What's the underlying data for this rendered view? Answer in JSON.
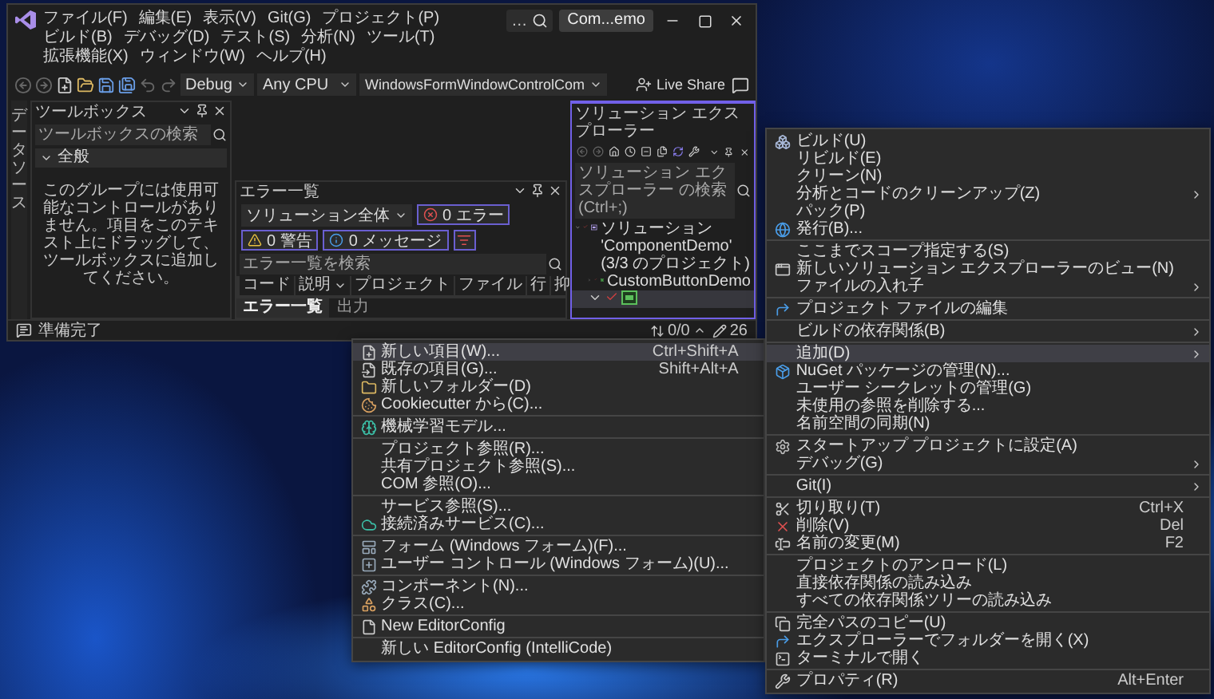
{
  "window": {
    "title": "Com...emo",
    "search_text": "…"
  },
  "menu_bar": [
    "ファイル(F)",
    "編集(E)",
    "表示(V)",
    "Git(G)",
    "プロジェクト(P)",
    "ビルド(B)",
    "デバッグ(D)",
    "テスト(S)",
    "分析(N)",
    "ツール(T)",
    "拡張機能(X)",
    "ウィンドウ(W)",
    "ヘルプ(H)"
  ],
  "toolbar": {
    "configuration": "Debug",
    "platform": "Any CPU",
    "startup_project": "WindowsFormWindowControlCom",
    "live_share": "Live Share"
  },
  "side_tabs": [
    {
      "label": "データソース"
    }
  ],
  "toolbox": {
    "title": "ツールボックス",
    "search_placeholder": "ツールボックスの検索",
    "groups": [
      {
        "label": "全般",
        "expanded": true,
        "message": "このグループには使用可能なコントロールがありません。項目をこのテキスト上にドラッグして、ツールボックスに追加してください。"
      }
    ]
  },
  "error_list": {
    "title": "エラー一覧",
    "scope": "ソリューション全体",
    "filters": [
      {
        "kind": "error",
        "label": "0 エラー",
        "selected": true
      },
      {
        "kind": "warning",
        "label": "0 警告",
        "selected": true
      },
      {
        "kind": "message",
        "label": "0 メッセージ",
        "selected": true
      }
    ],
    "search_placeholder": "エラー一覧を検索",
    "columns": [
      {
        "label": "コード",
        "has_menu": false
      },
      {
        "label": "説明",
        "has_menu": true
      },
      {
        "label": "プロジェクト",
        "has_menu": false
      },
      {
        "label": "ファイル",
        "has_menu": false
      },
      {
        "label": "行",
        "has_menu": false
      },
      {
        "label": "抑",
        "has_menu": false
      }
    ],
    "tabs": [
      {
        "label": "エラー一覧",
        "selected": true
      },
      {
        "label": "出力",
        "selected": false
      }
    ]
  },
  "solution_explorer": {
    "title": "ソリューション エクスプローラー",
    "search_placeholder": "ソリューション エクスプローラー の検索 (Ctrl+;)",
    "tree": [
      {
        "label": "ソリューション 'ComponentDemo' (3/3 のプロジェクト)",
        "kind": "solution",
        "expanded": true,
        "selected": false,
        "children": [
          {
            "label": "CustomButtonDemo",
            "kind": "project",
            "expanded": false,
            "selected": false
          },
          {
            "kind": "project",
            "expanded": true,
            "selected": true
          }
        ]
      }
    ]
  },
  "status_bar": {
    "text": "準備完了",
    "changes": "0/0",
    "edits": "26"
  },
  "context_menu": {
    "sections": [
      [
        {
          "label": "ビルド(U)",
          "kind": "build",
          "submenu": false,
          "highlighted": false
        },
        {
          "label": "リビルド(E)",
          "kind": "plain",
          "submenu": false,
          "highlighted": false
        },
        {
          "label": "クリーン(N)",
          "kind": "plain",
          "submenu": false,
          "highlighted": false
        },
        {
          "label": "分析とコードのクリーンアップ(Z)",
          "kind": "plain",
          "submenu": true,
          "highlighted": false
        },
        {
          "label": "パック(P)",
          "kind": "plain",
          "submenu": false,
          "highlighted": false
        },
        {
          "label": "発行(B)...",
          "kind": "publish",
          "submenu": false,
          "highlighted": false
        }
      ],
      [
        {
          "label": "ここまでスコープ指定する(S)",
          "kind": "plain",
          "submenu": false,
          "highlighted": false
        },
        {
          "label": "新しいソリューション エクスプローラーのビュー(N)",
          "kind": "new_view",
          "submenu": false,
          "highlighted": false
        },
        {
          "label": "ファイルの入れ子",
          "kind": "plain",
          "submenu": true,
          "highlighted": false
        }
      ],
      [
        {
          "label": "プロジェクト ファイルの編集",
          "kind": "edit_file",
          "submenu": false,
          "highlighted": false
        }
      ],
      [
        {
          "label": "ビルドの依存関係(B)",
          "kind": "plain",
          "submenu": true,
          "highlighted": false
        }
      ],
      [
        {
          "label": "追加(D)",
          "kind": "plain",
          "submenu": true,
          "highlighted": true
        },
        {
          "label": "NuGet パッケージの管理(N)...",
          "kind": "nuget",
          "submenu": false,
          "highlighted": false
        },
        {
          "label": "ユーザー シークレットの管理(G)",
          "kind": "plain",
          "submenu": false,
          "highlighted": false
        },
        {
          "label": "未使用の参照を削除する...",
          "kind": "plain",
          "submenu": false,
          "highlighted": false
        },
        {
          "label": "名前空間の同期(N)",
          "kind": "plain",
          "submenu": false,
          "highlighted": false
        }
      ],
      [
        {
          "label": "スタートアップ プロジェクトに設定(A)",
          "kind": "startup",
          "submenu": false,
          "highlighted": false
        },
        {
          "label": "デバッグ(G)",
          "kind": "plain",
          "submenu": true,
          "highlighted": false
        }
      ],
      [
        {
          "label": "Git(I)",
          "kind": "plain",
          "submenu": true,
          "highlighted": false
        }
      ],
      [
        {
          "label": "切り取り(T)",
          "kind": "cut",
          "shortcut": "Ctrl+X",
          "submenu": false,
          "highlighted": false
        },
        {
          "label": "削除(V)",
          "kind": "delete",
          "shortcut": "Del",
          "submenu": false,
          "highlighted": false
        },
        {
          "label": "名前の変更(M)",
          "kind": "rename",
          "shortcut": "F2",
          "submenu": false,
          "highlighted": false
        }
      ],
      [
        {
          "label": "プロジェクトのアンロード(L)",
          "kind": "plain",
          "submenu": false,
          "highlighted": false
        },
        {
          "label": "直接依存関係の読み込み",
          "kind": "plain",
          "submenu": false,
          "highlighted": false
        },
        {
          "label": "すべての依存関係ツリーの読み込み",
          "kind": "plain",
          "submenu": false,
          "highlighted": false
        }
      ],
      [
        {
          "label": "完全パスのコピー(U)",
          "kind": "copy",
          "submenu": false,
          "highlighted": false
        },
        {
          "label": "エクスプローラーでフォルダーを開く(X)",
          "kind": "open_folder",
          "submenu": false,
          "highlighted": false
        },
        {
          "label": "ターミナルで開く",
          "kind": "terminal",
          "submenu": false,
          "highlighted": false
        }
      ],
      [
        {
          "label": "プロパティ(R)",
          "kind": "properties",
          "shortcut": "Alt+Enter",
          "submenu": false,
          "highlighted": false
        }
      ]
    ]
  },
  "add_submenu": {
    "sections": [
      [
        {
          "label": "新しい項目(W)...",
          "kind": "new_item",
          "shortcut": "Ctrl+Shift+A",
          "highlighted": true
        },
        {
          "label": "既存の項目(G)...",
          "kind": "existing_item",
          "shortcut": "Shift+Alt+A",
          "highlighted": false
        },
        {
          "label": "新しいフォルダー(D)",
          "kind": "folder",
          "highlighted": false
        },
        {
          "label": "Cookiecutter から(C)...",
          "kind": "cookiecutter",
          "highlighted": false
        }
      ],
      [
        {
          "label": "機械学習モデル...",
          "kind": "ml_model",
          "highlighted": false
        }
      ],
      [
        {
          "label": "プロジェクト参照(R)...",
          "kind": "plain",
          "highlighted": false
        },
        {
          "label": "共有プロジェクト参照(S)...",
          "kind": "plain",
          "highlighted": false
        },
        {
          "label": "COM 参照(O)...",
          "kind": "plain",
          "highlighted": false
        }
      ],
      [
        {
          "label": "サービス参照(S)...",
          "kind": "plain",
          "highlighted": false
        },
        {
          "label": "接続済みサービス(C)...",
          "kind": "connected_service",
          "highlighted": false
        }
      ],
      [
        {
          "label": "フォーム (Windows フォーム)(F)...",
          "kind": "form",
          "highlighted": false
        },
        {
          "label": "ユーザー コントロール (Windows フォーム)(U)...",
          "kind": "user_control",
          "highlighted": false
        }
      ],
      [
        {
          "label": "コンポーネント(N)...",
          "kind": "component",
          "highlighted": false
        },
        {
          "label": "クラス(C)...",
          "kind": "class",
          "highlighted": false
        }
      ],
      [
        {
          "label": "New EditorConfig",
          "kind": "editorconfig",
          "highlighted": false
        }
      ],
      [
        {
          "label": "新しい EditorConfig (IntelliCode)",
          "kind": "plain",
          "highlighted": false
        }
      ]
    ]
  }
}
